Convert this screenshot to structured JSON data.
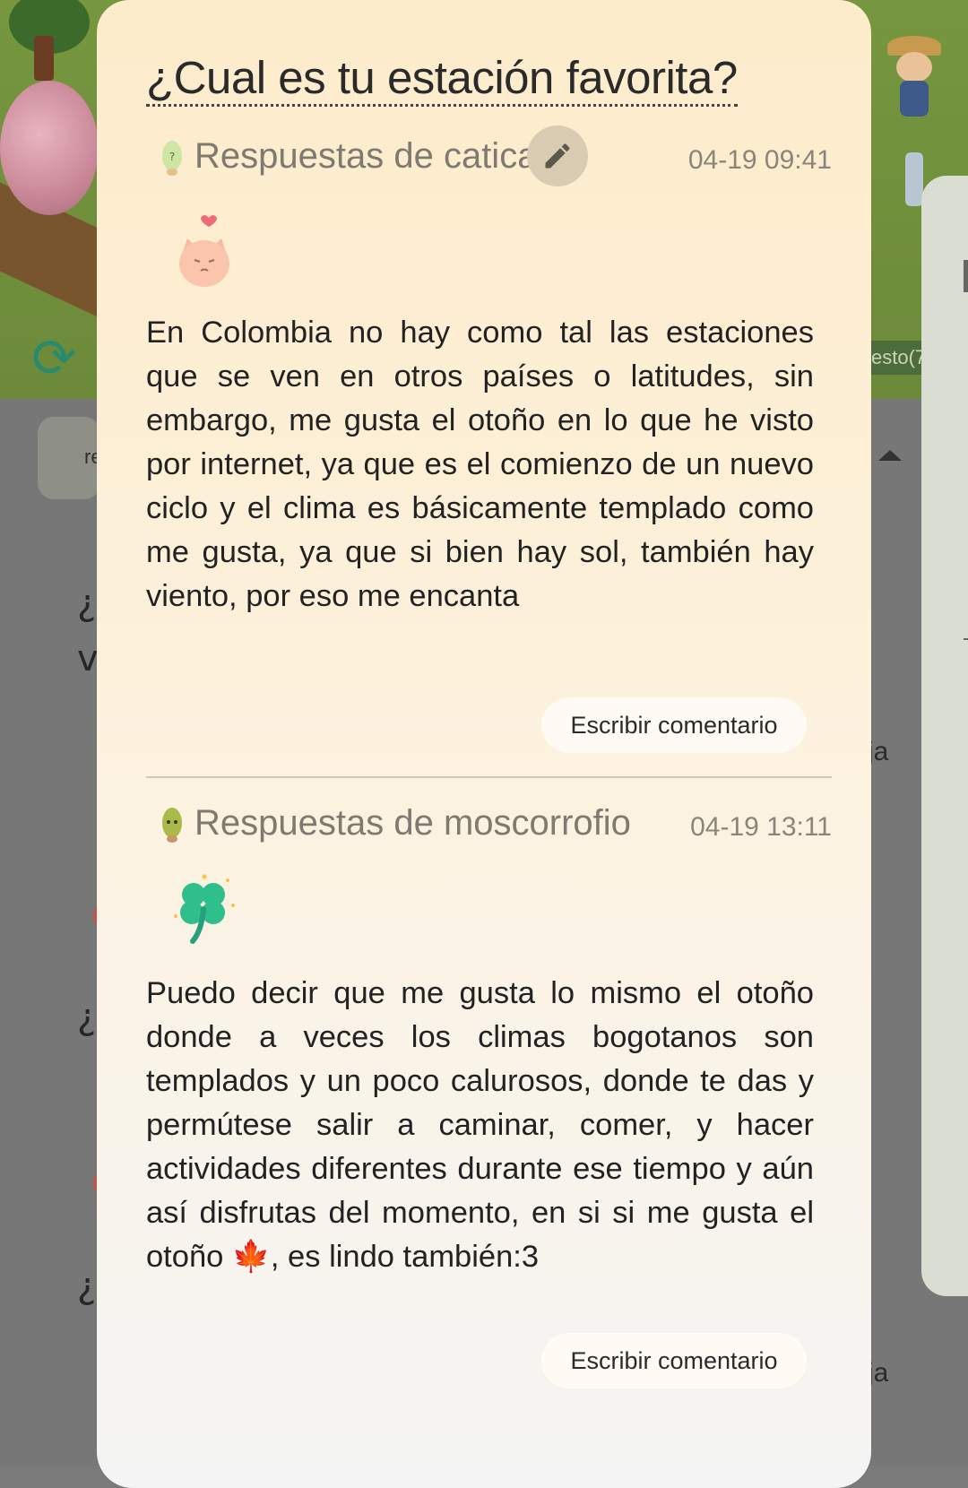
{
  "background": {
    "counter_text": "esto(7",
    "pill_text": "re",
    "right_texts": [
      "ja",
      "ja"
    ],
    "list_initials": [
      "¿S",
      "v",
      "¿C",
      "¿U"
    ]
  },
  "question": {
    "title": "¿Cual es tu estación favorita?"
  },
  "answers": [
    {
      "name": "Respuestas de catica",
      "time": "04-19 09:41",
      "sticker": "cat-sticker",
      "text": "En Colombia no hay como tal las estaciones que se ven en otros países o latitudes, sin embargo, me gusta el otoño en lo que he visto por internet, ya que es el comienzo de un nuevo ciclo y el clima es básicamente templado como me gusta, ya que si bien hay sol, también hay viento, por eso me encanta",
      "comment_label": "Escribir comentario",
      "avatar_color": "#cde3a3"
    },
    {
      "name": "Respuestas de moscorrofio",
      "time": "04-19 13:11",
      "sticker": "clover-sticker",
      "text": "Puedo decir que me gusta lo mismo el otoño donde a veces los climas bogotanos son templados y un poco calurosos, donde te das y permútese salir a caminar, comer, y hacer actividades diferentes durante ese tiempo y aún así disfrutas del momento, en si si me gusta el otoño 🍁, es lindo también:3",
      "comment_label": "Escribir comentario",
      "avatar_color": "#a9b848"
    }
  ],
  "colors": {
    "card_top": "#fdeccb",
    "card_bottom": "#f4f4f4",
    "edit_button": "#d9ccb2",
    "clover": "#2fbf8c"
  }
}
